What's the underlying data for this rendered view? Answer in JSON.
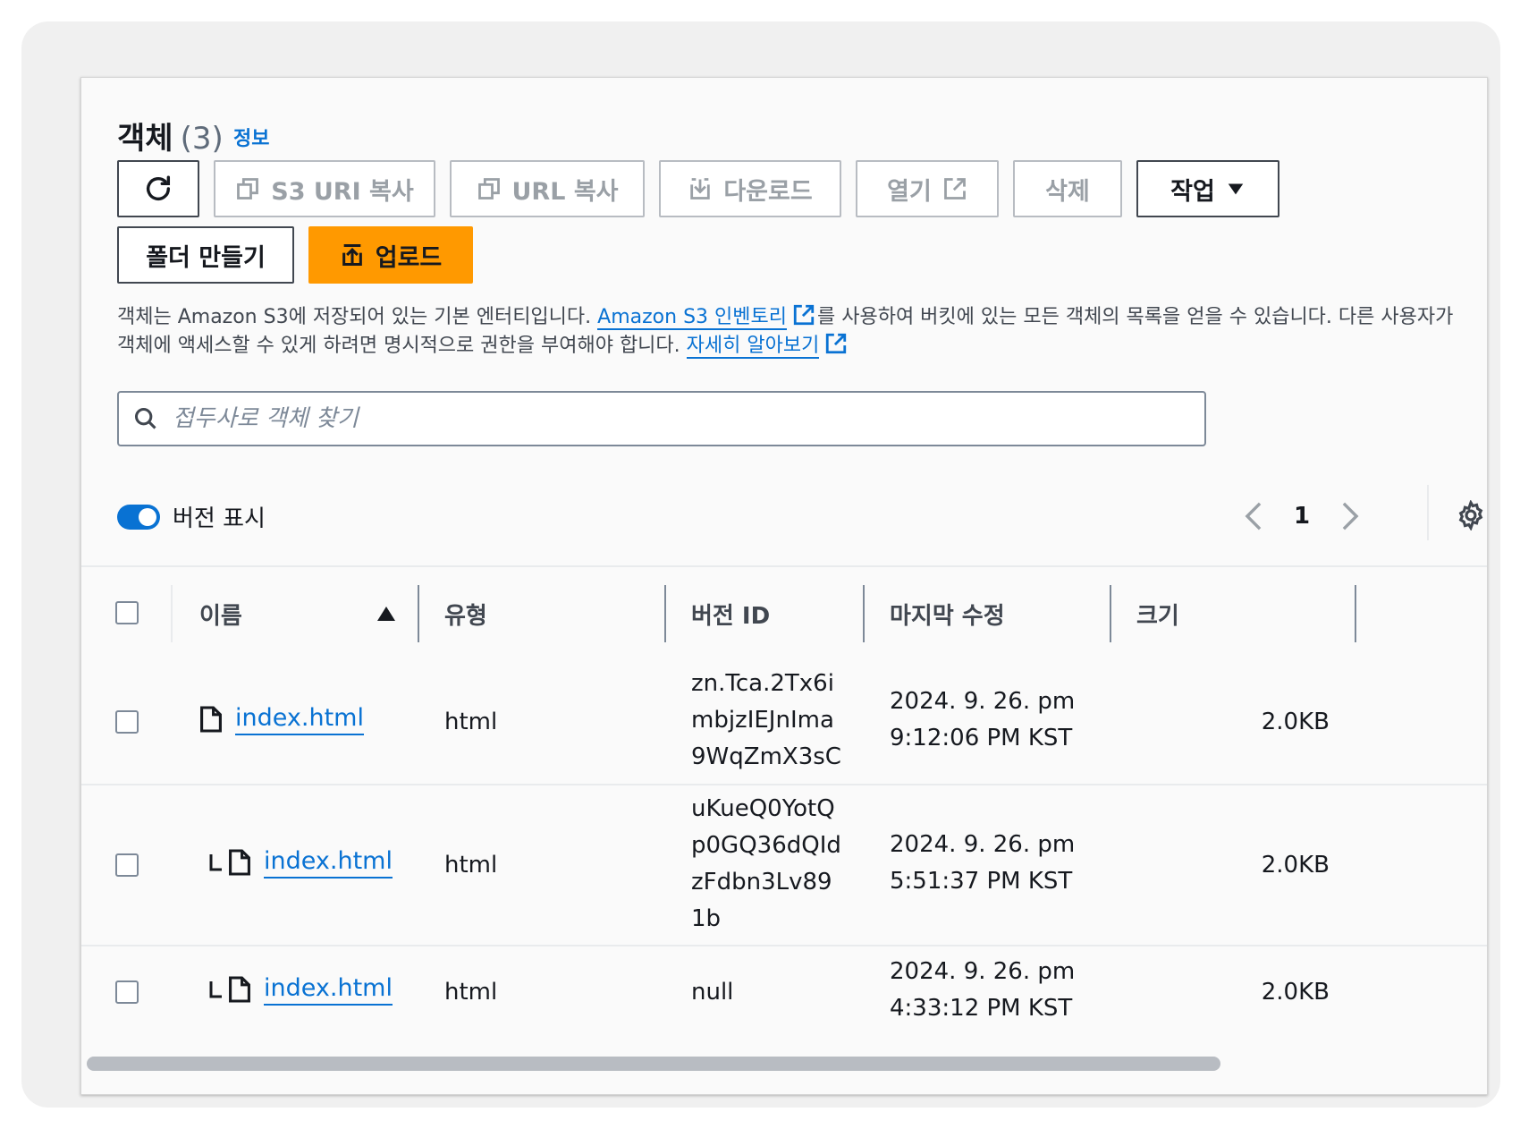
{
  "header": {
    "title": "객체",
    "count": "(3)",
    "info_link": "정보"
  },
  "toolbar": {
    "refresh_label": "",
    "copy_s3_uri": "S3 URI 복사",
    "copy_url": "URL 복사",
    "download": "다운로드",
    "open": "열기",
    "delete": "삭제",
    "actions": "작업",
    "create_folder": "폴더 만들기",
    "upload": "업로드"
  },
  "description": {
    "part1": "객체는 Amazon S3에 저장되어 있는 기본 엔터티입니다. ",
    "inventory_link": "Amazon S3 인벤토리",
    "part2": "를 사용하여 버킷에 있는 모든 객체의 목록을 얻을 수 있습니다. 다른 사용자가 객체에 액세스할 수 있게 하려면 명시적으로 권한을 부여해야 합니다. ",
    "learn_more_link": "자세히 알아보기"
  },
  "search": {
    "placeholder": "접두사로 객체 찾기",
    "value": ""
  },
  "versions_toggle": {
    "label": "버전 표시",
    "enabled": true
  },
  "pagination": {
    "page": "1"
  },
  "table": {
    "columns": [
      "이름",
      "유형",
      "버전 ID",
      "마지막 수정",
      "크기"
    ],
    "sort_column": "이름",
    "rows": [
      {
        "name": "index.html",
        "type": "html",
        "version_id": "zn.Tca.2Tx6imbjzIEJnIma9WqZmX3sC",
        "modified_line1": "2024. 9. 26. pm",
        "modified_line2": "9:12:06 PM KST",
        "size": "2.0KB",
        "is_version": false
      },
      {
        "name": "index.html",
        "type": "html",
        "version_id": "uKueQ0YotQp0GQ36dQIdzFdbn3Lv891b",
        "modified_line1": "2024. 9. 26. pm",
        "modified_line2": "5:51:37 PM KST",
        "size": "2.0KB",
        "is_version": true
      },
      {
        "name": "index.html",
        "type": "html",
        "version_id": "null",
        "modified_line1": "2024. 9. 26. pm",
        "modified_line2": "4:33:12 PM KST",
        "size": "2.0KB",
        "is_version": true
      }
    ]
  },
  "colors": {
    "accent": "#0972d3",
    "primary_button": "#ff9900",
    "text": "#16191f",
    "muted": "#9aa0a6"
  },
  "icons": [
    "refresh-icon",
    "copy-icon",
    "download-icon",
    "external-link-icon",
    "caret-down-icon",
    "upload-icon",
    "search-icon",
    "chevron-left-icon",
    "chevron-right-icon",
    "gear-icon",
    "sort-up-icon",
    "file-icon",
    "version-branch-icon"
  ]
}
